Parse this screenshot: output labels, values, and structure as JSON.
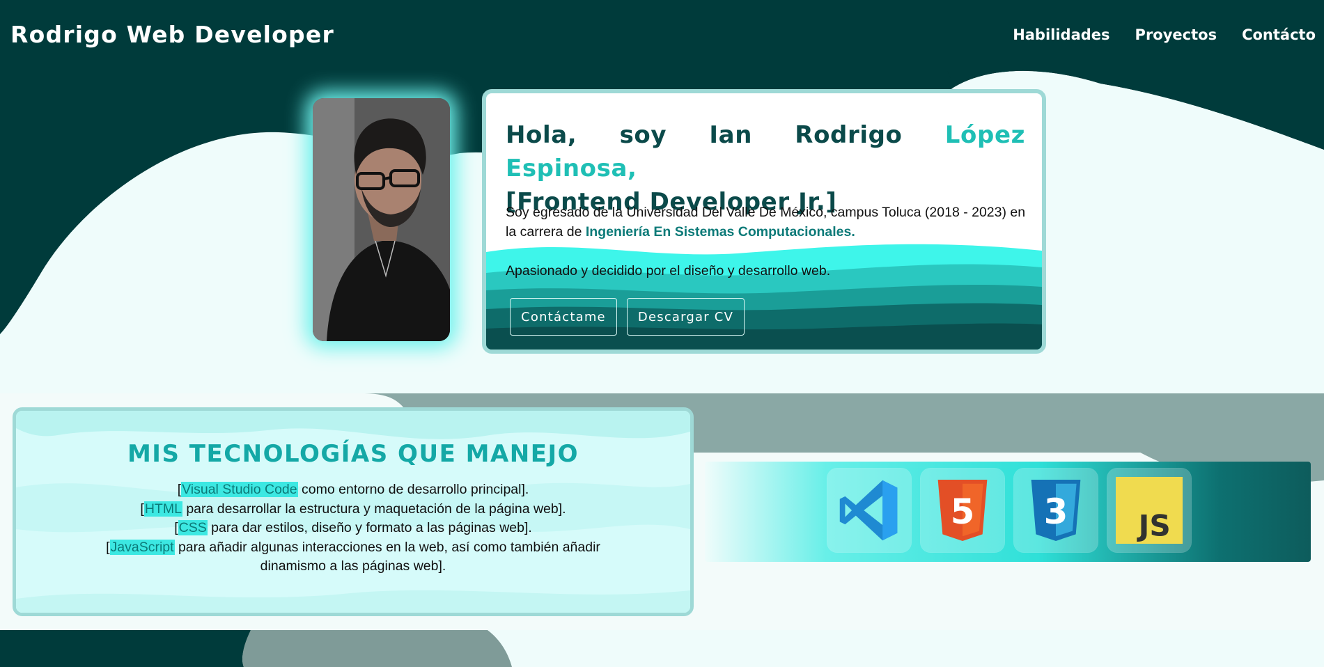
{
  "header": {
    "brand": "Rodrigo Web Developer",
    "nav": [
      "Habilidades",
      "Proyectos",
      "Contácto"
    ]
  },
  "intro": {
    "title_greeting": "Hola, soy Ian Rodrigo ",
    "title_name_accent": "López Espinosa,",
    "title_role": "[Frontend Developer Jr.]",
    "p1_before": "Soy egresado de la Universidad Del Valle De México, campus Toluca (2018 - 2023) en la carrera de ",
    "p1_highlight": "Ingeniería En Sistemas Computacionales.",
    "p2": "Apasionado y decidido por el diseño y desarrollo web.",
    "button_contact": "Contáctame",
    "button_cv": "Descargar CV"
  },
  "tech": {
    "title": "MIS TECNOLOGÍAS QUE MANEJO",
    "items": [
      {
        "open": "[",
        "name": "Visual Studio Code",
        "text": " como entorno de desarrollo principal]."
      },
      {
        "open": "[",
        "name": "HTML",
        "text": " para desarrollar la estructura y maquetación de la página web]."
      },
      {
        "open": "[",
        "name": "CSS",
        "text": " para dar estilos, diseño y formato a las páginas web]."
      },
      {
        "open": "[",
        "name": "JavaScript",
        "text": " para añadir algunas interacciones en la web, así como también añadir"
      },
      {
        "open": "",
        "name": "",
        "text": "dinamismo a las páginas web]."
      }
    ],
    "icons": [
      "vscode-icon",
      "html5-icon",
      "css3-icon",
      "javascript-icon"
    ],
    "icon_labels": {
      "html": "5",
      "css": "3",
      "js": "JS"
    }
  },
  "colors": {
    "header_bg": "#003b3b",
    "accent": "#1fbfb5",
    "dark_text": "#0b4a4a"
  }
}
